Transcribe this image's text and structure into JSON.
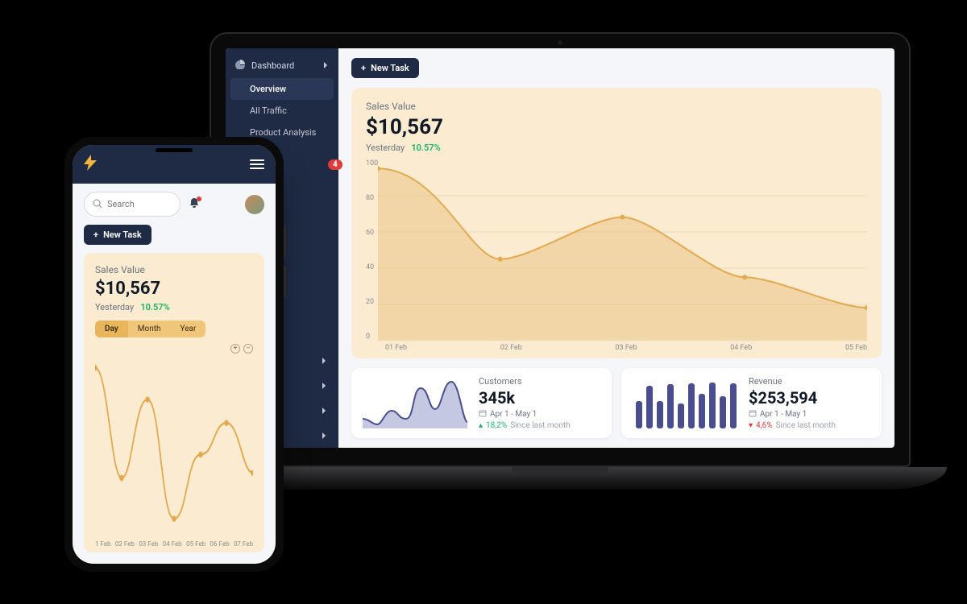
{
  "colors": {
    "accent": "#e2a94f",
    "sidebar": "#1f2a44",
    "green": "#18b26b",
    "red": "#e03b3b",
    "purple": "#4a4e8f"
  },
  "sidebar": {
    "items": [
      {
        "label": "Dashboard",
        "icon": "pie-icon",
        "expandable": true
      },
      {
        "label": "Overview",
        "sub": true,
        "active": true
      },
      {
        "label": "All Traffic",
        "sub": true
      },
      {
        "label": "Product Analysis",
        "sub": true
      }
    ],
    "notification_count": "4"
  },
  "toolbar": {
    "new_task_label": "New Task",
    "search_placeholder": "Search"
  },
  "sales_card": {
    "title": "Sales Value",
    "value": "$10,567",
    "sub_label": "Yesterday",
    "sub_pct": "10.57%"
  },
  "range_tabs": {
    "day": "Day",
    "month": "Month",
    "year": "Year"
  },
  "customers_card": {
    "label": "Customers",
    "value": "345k",
    "range": "Apr 1 - May 1",
    "delta_pct": "18,2%",
    "delta_suffix": "Since last month",
    "delta_dir": "up"
  },
  "revenue_card": {
    "label": "Revenue",
    "value": "$253,594",
    "range": "Apr 1 - May 1",
    "delta_pct": "4,6%",
    "delta_suffix": "Since last month",
    "delta_dir": "down"
  },
  "chart_data": [
    {
      "id": "sales_value_main",
      "type": "area",
      "title": "Sales Value",
      "xlabel": "",
      "ylabel": "",
      "ylim": [
        0,
        100
      ],
      "y_ticks": [
        0,
        20,
        40,
        60,
        80,
        100
      ],
      "categories": [
        "01 Feb",
        "02 Feb",
        "03 Feb",
        "04 Feb",
        "05 Feb"
      ],
      "values": [
        95,
        45,
        68,
        35,
        18
      ]
    },
    {
      "id": "sales_value_mobile",
      "type": "line",
      "title": "Sales Value",
      "ylim": [
        0,
        100
      ],
      "categories": [
        "1 Feb",
        "02 Feb",
        "03 Feb",
        "04 Feb",
        "05 Feb",
        "06 Feb",
        "07 Feb"
      ],
      "values": [
        92,
        32,
        75,
        10,
        45,
        62,
        35
      ]
    },
    {
      "id": "customers_spark",
      "type": "area",
      "ylim": [
        0,
        100
      ],
      "x": [
        0,
        1,
        2,
        3,
        4,
        5,
        6,
        7
      ],
      "values": [
        20,
        8,
        35,
        18,
        80,
        40,
        95,
        15
      ]
    },
    {
      "id": "revenue_bars",
      "type": "bar",
      "ylim": [
        0,
        100
      ],
      "categories": [
        "1",
        "2",
        "3",
        "4",
        "5",
        "6",
        "7",
        "8",
        "9",
        "10"
      ],
      "values": [
        55,
        85,
        55,
        88,
        50,
        90,
        70,
        92,
        65,
        90
      ]
    }
  ]
}
